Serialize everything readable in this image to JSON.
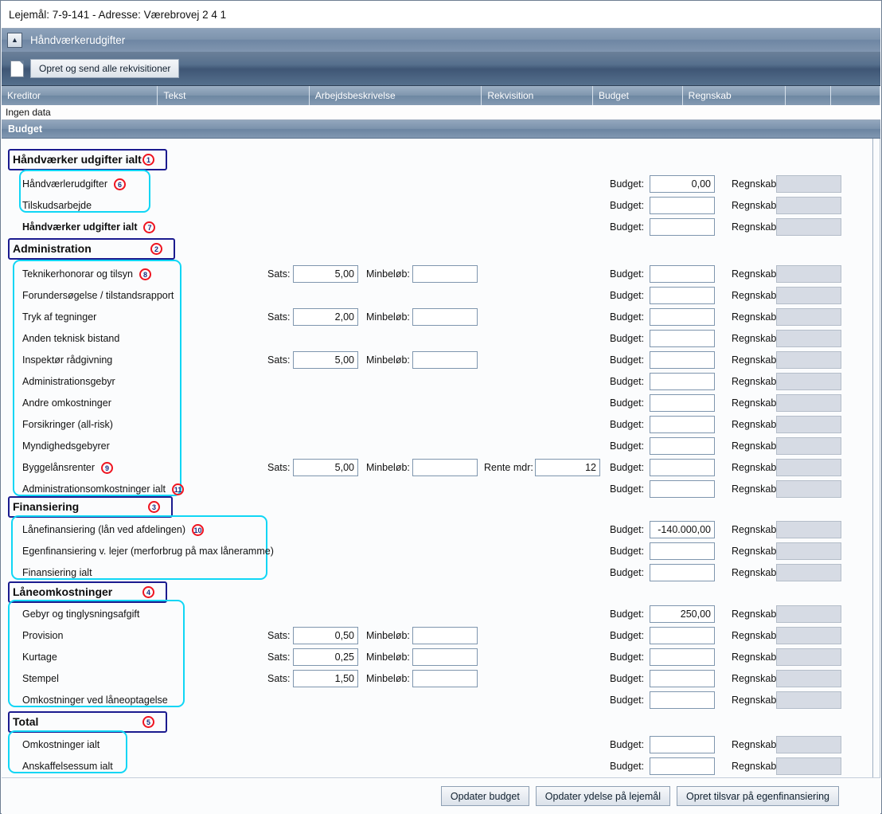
{
  "window": {
    "title": "Lejemål: 7-9-141 - Adresse: Værebrovej 2 4 1"
  },
  "group_header": {
    "label": "Håndværkerudgifter",
    "collapse_icon": "chevron-up-icon"
  },
  "toolbar": {
    "doc_icon": "document-icon",
    "create_send_label": "Opret og send alle rekvisitioner"
  },
  "grid": {
    "columns": [
      "Kreditor",
      "Tekst",
      "Arbejdsbeskrivelse",
      "Rekvisition",
      "Budget",
      "Regnskab",
      "",
      ""
    ],
    "empty_text": "Ingen data"
  },
  "budget_bar": {
    "label": "Budget"
  },
  "labels": {
    "budget": "Budget:",
    "regnskab": "Regnskab:",
    "sats": "Sats:",
    "minbelob": "Minbeløb:",
    "rente_mdr": "Rente mdr:"
  },
  "sections": [
    {
      "title": "Håndværker udgifter ialt",
      "anno": "1",
      "rows": [
        {
          "label": "Håndværlerudgifter",
          "anno": "6",
          "budget": "0,00",
          "regnskab": ""
        },
        {
          "label": "Tilskudsarbejde",
          "anno": "",
          "budget": "",
          "regnskab": ""
        },
        {
          "label": "Håndværker udgifter ialt",
          "anno": "7",
          "budget": "",
          "regnskab": "",
          "bold": true
        }
      ]
    },
    {
      "title": "Administration",
      "anno": "2",
      "rows": [
        {
          "label": "Teknikerhonorar og tilsyn",
          "anno": "8",
          "sats": "5,00",
          "minbelob": "",
          "budget": "",
          "regnskab": ""
        },
        {
          "label": "Forundersøgelse / tilstandsrapport",
          "anno": "",
          "budget": "",
          "regnskab": ""
        },
        {
          "label": "Tryk af tegninger",
          "anno": "",
          "sats": "2,00",
          "minbelob": "",
          "budget": "",
          "regnskab": ""
        },
        {
          "label": "Anden teknisk bistand",
          "anno": "",
          "budget": "",
          "regnskab": ""
        },
        {
          "label": "Inspektør rådgivning",
          "anno": "",
          "sats": "5,00",
          "minbelob": "",
          "budget": "",
          "regnskab": ""
        },
        {
          "label": "Administrationsgebyr",
          "anno": "",
          "budget": "",
          "regnskab": ""
        },
        {
          "label": "Andre omkostninger",
          "anno": "",
          "budget": "",
          "regnskab": ""
        },
        {
          "label": "Forsikringer (all-risk)",
          "anno": "",
          "budget": "",
          "regnskab": ""
        },
        {
          "label": "Myndighedsgebyrer",
          "anno": "",
          "budget": "",
          "regnskab": ""
        },
        {
          "label": "Byggelånsrenter",
          "anno": "9",
          "sats": "5,00",
          "minbelob": "",
          "rente_mdr": "12",
          "budget": "",
          "regnskab": ""
        },
        {
          "label": "Administrationsomkostninger ialt",
          "anno": "11",
          "budget": "",
          "regnskab": ""
        }
      ]
    },
    {
      "title": "Finansiering",
      "anno": "3",
      "rows": [
        {
          "label": "Lånefinansiering (lån ved afdelingen)",
          "anno": "10",
          "budget": "-140.000,00",
          "regnskab": ""
        },
        {
          "label": "Egenfinansiering v. lejer (merforbrug på max låneramme)",
          "anno": "",
          "budget": "",
          "regnskab": ""
        },
        {
          "label": "Finansiering ialt",
          "anno": "",
          "budget": "",
          "regnskab": ""
        }
      ]
    },
    {
      "title": "Låneomkostninger",
      "anno": "4",
      "rows": [
        {
          "label": "Gebyr og tinglysningsafgift",
          "anno": "",
          "budget": "250,00",
          "regnskab": ""
        },
        {
          "label": "Provision",
          "anno": "",
          "sats": "0,50",
          "minbelob": "",
          "budget": "",
          "regnskab": ""
        },
        {
          "label": "Kurtage",
          "anno": "",
          "sats": "0,25",
          "minbelob": "",
          "budget": "",
          "regnskab": ""
        },
        {
          "label": "Stempel",
          "anno": "",
          "sats": "1,50",
          "minbelob": "",
          "budget": "",
          "regnskab": ""
        },
        {
          "label": "Omkostninger ved låneoptagelse",
          "anno": "",
          "budget": "",
          "regnskab": ""
        }
      ]
    },
    {
      "title": "Total",
      "anno": "5",
      "rows": [
        {
          "label": "Omkostninger ialt",
          "anno": "",
          "budget": "",
          "regnskab": ""
        },
        {
          "label": "Anskaffelsessum ialt",
          "anno": "",
          "budget": "",
          "regnskab": ""
        }
      ]
    }
  ],
  "footer": {
    "buttons": [
      "Opdater budget",
      "Opdater ydelse på lejemål",
      "Opret tilsvar på egenfinansiering"
    ]
  }
}
